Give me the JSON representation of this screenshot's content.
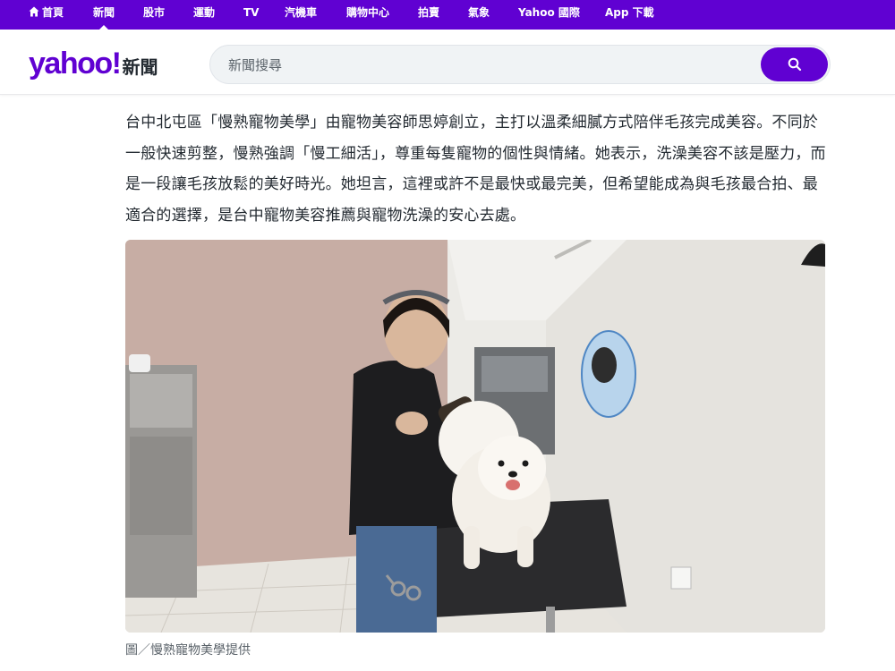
{
  "topnav": {
    "items": [
      {
        "label": "首頁",
        "icon": "home-icon",
        "active": false
      },
      {
        "label": "新聞",
        "active": true
      },
      {
        "label": "股市",
        "active": false
      },
      {
        "label": "運動",
        "active": false
      },
      {
        "label": "TV",
        "active": false
      },
      {
        "label": "汽機車",
        "active": false
      },
      {
        "label": "購物中心",
        "active": false
      },
      {
        "label": "拍賣",
        "active": false
      },
      {
        "label": "氣象",
        "active": false
      },
      {
        "label": "Yahoo 國際",
        "active": false
      },
      {
        "label": "App 下載",
        "active": false
      }
    ],
    "bg_color": "#6001d2"
  },
  "header": {
    "logo_text": "yahoo!",
    "logo_sub": "新聞",
    "search_placeholder": "新聞搜尋",
    "search_icon": "search-icon"
  },
  "article": {
    "paragraph": "台中北屯區「慢熟寵物美學」由寵物美容師思婷創立，主打以溫柔細膩方式陪伴毛孩完成美容。不同於一般快速剪整，慢熟強調「慢工細活」，尊重每隻寵物的個性與情緒。她表示，洗澡美容不該是壓力，而是一段讓毛孩放鬆的美好時光。她坦言，這裡或許不是最快或最完美，但希望能成為與毛孩最合拍、最適合的選擇，是台中寵物美容推薦與寵物洗澡的安心去處。",
    "photo_caption": "圖／慢熟寵物美學提供"
  }
}
